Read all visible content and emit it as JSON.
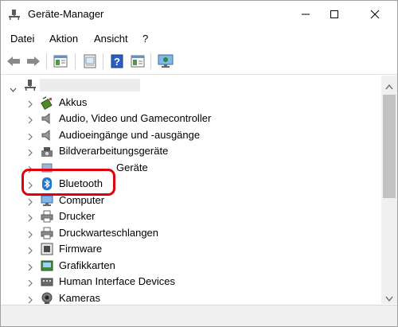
{
  "window": {
    "title": "Geräte-Manager"
  },
  "menu": [
    {
      "label": "Datei"
    },
    {
      "label": "Aktion"
    },
    {
      "label": "Ansicht"
    },
    {
      "label": "?"
    }
  ],
  "toolbar": {
    "buttons": [
      "back-arrow-icon",
      "forward-arrow-icon",
      "properties-icon",
      "driver-icon",
      "help-icon",
      "scan-hardware-icon",
      "monitor-icon"
    ]
  },
  "tree": {
    "items": [
      {
        "label": "Akkus",
        "icon": "battery-icon"
      },
      {
        "label": "Audio, Video und Gamecontroller",
        "icon": "speaker-icon"
      },
      {
        "label": "Audioeingänge und -ausgänge",
        "icon": "speaker-icon"
      },
      {
        "label": "Bildverarbeitungsgeräte",
        "icon": "camera-icon"
      },
      {
        "label": "Geräte",
        "icon": "device-icon"
      },
      {
        "label": "Bluetooth",
        "icon": "bluetooth-icon",
        "selected": true
      },
      {
        "label": "Computer",
        "icon": "computer-icon"
      },
      {
        "label": "Drucker",
        "icon": "printer-icon"
      },
      {
        "label": "Druckwarteschlangen",
        "icon": "printer-icon"
      },
      {
        "label": "Firmware",
        "icon": "firmware-icon"
      },
      {
        "label": "Grafikkarten",
        "icon": "display-adapter-icon"
      },
      {
        "label": "Human Interface Devices",
        "icon": "hid-icon"
      },
      {
        "label": "Kameras",
        "icon": "webcam-icon"
      }
    ]
  },
  "colors": {
    "highlight_ring": "#e0000d",
    "bluetooth": "#1e78d2",
    "selection": "#cce8ff"
  }
}
